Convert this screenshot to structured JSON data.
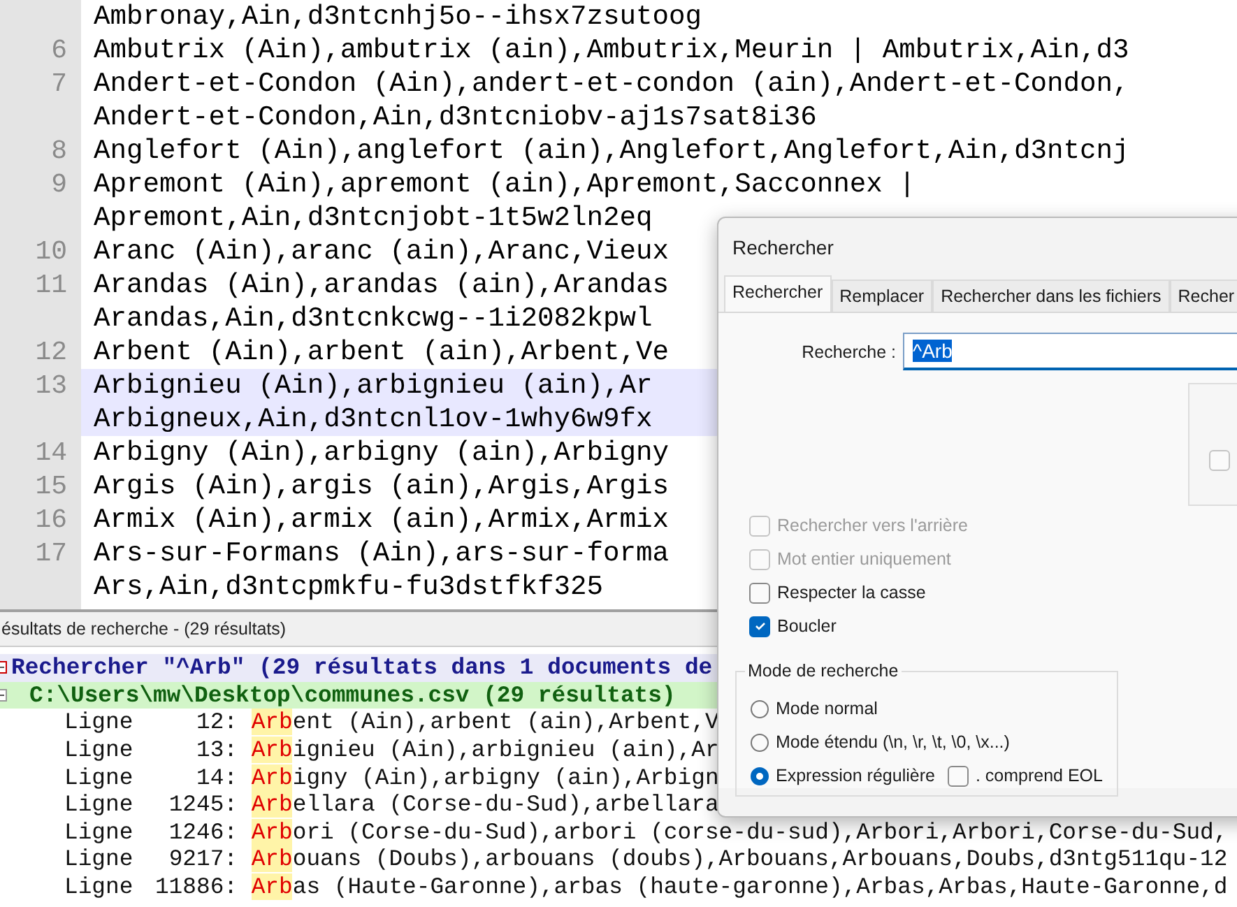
{
  "editor": {
    "lines": [
      {
        "text": "Ambronay,Ain,d3ntcnhj5o--ihsx7zsutoog",
        "current": false
      },
      {
        "number": "6",
        "text": "Ambutrix (Ain),ambutrix (ain),Ambutrix,Meurin | Ambutrix,Ain,d3",
        "current": false
      },
      {
        "number": "7",
        "text": "Andert-et-Condon (Ain),andert-et-condon (ain),Andert-et-Condon,",
        "current": false
      },
      {
        "text": "Andert-et-Condon,Ain,d3ntcniobv-aj1s7sat8i36",
        "current": false
      },
      {
        "number": "8",
        "text": "Anglefort (Ain),anglefort (ain),Anglefort,Anglefort,Ain,d3ntcnj",
        "current": false
      },
      {
        "number": "9",
        "text": "Apremont (Ain),apremont (ain),Apremont,Sacconnex |",
        "current": false
      },
      {
        "text": "Apremont,Ain,d3ntcnjobt-1t5w2ln2eq",
        "current": false
      },
      {
        "number": "10",
        "text": "Aranc (Ain),aranc (ain),Aranc,Vieux",
        "current": false
      },
      {
        "number": "11",
        "text": "Arandas (Ain),arandas (ain),Arandas",
        "current": false
      },
      {
        "text": "Arandas,Ain,d3ntcnkcwg--1i2082kpwl",
        "current": false
      },
      {
        "number": "12",
        "text": "Arbent (Ain),arbent (ain),Arbent,Ve",
        "current": false
      },
      {
        "number": "13",
        "text": "Arbignieu (Ain),arbignieu (ain),Ar",
        "current": true
      },
      {
        "text": "Arbigneux,Ain,d3ntcnl1ov-1why6w9fx",
        "current": true
      },
      {
        "number": "14",
        "text": "Arbigny (Ain),arbigny (ain),Arbigny",
        "current": false
      },
      {
        "number": "15",
        "text": "Argis (Ain),argis (ain),Argis,Argis",
        "current": false
      },
      {
        "number": "16",
        "text": "Armix (Ain),armix (ain),Armix,Armix",
        "current": false
      },
      {
        "number": "17",
        "text": "Ars-sur-Formans (Ain),ars-sur-forma",
        "current": false
      },
      {
        "text": "Ars,Ain,d3ntcpmkfu-fu3dstfkf325",
        "current": false
      }
    ]
  },
  "results": {
    "title": "ésultats de recherche - (29 résultats)",
    "search_header": "Rechercher \"^Arb\" (29 résultats dans 1 documents de",
    "file_header": "C:\\Users\\mw\\Desktop\\communes.csv (29 résultats)",
    "rows": [
      {
        "label": "Ligne",
        "line": "12:",
        "match": "Arb",
        "rest": "ent (Ain),arbent (ain),Arbent,V"
      },
      {
        "label": "Ligne",
        "line": "13:",
        "match": "Arb",
        "rest": "ignieu (Ain),arbignieu (ain),Ar"
      },
      {
        "label": "Ligne",
        "line": "14:",
        "match": "Arb",
        "rest": "igny (Ain),arbigny (ain),Arbign"
      },
      {
        "label": "Ligne",
        "line": "1245:",
        "match": "Arb",
        "rest": "ellara (Corse-du-Sud),arbellara"
      },
      {
        "label": "Ligne",
        "line": "1246:",
        "match": "Arb",
        "rest": "ori (Corse-du-Sud),arbori (corse-du-sud),Arbori,Arbori,Corse-du-Sud,"
      },
      {
        "label": "Ligne",
        "line": "9217:",
        "match": "Arb",
        "rest": "ouans (Doubs),arbouans (doubs),Arbouans,Arbouans,Doubs,d3ntg511qu-12"
      },
      {
        "label": "Ligne",
        "line": "11886:",
        "match": "Arb",
        "rest": "as (Haute-Garonne),arbas (haute-garonne),Arbas,Arbas,Haute-Garonne,d"
      }
    ]
  },
  "dialog": {
    "title": "Rechercher",
    "tabs": [
      {
        "label": "Rechercher",
        "selected": true
      },
      {
        "label": "Remplacer",
        "selected": false
      },
      {
        "label": "Rechercher dans les fichiers",
        "selected": false
      },
      {
        "label": "Recher",
        "selected": false
      }
    ],
    "search_label": "Recherche :",
    "search_value": "^Arb",
    "side_checkbox": {
      "checked": false,
      "disabled": true
    },
    "options": [
      {
        "label": "Rechercher vers l'arrière",
        "checked": false,
        "disabled": true
      },
      {
        "label": "Mot entier uniquement",
        "checked": false,
        "disabled": true
      },
      {
        "label": "Respecter la casse",
        "checked": false,
        "disabled": false
      },
      {
        "label": "Boucler",
        "checked": true,
        "disabled": false
      }
    ],
    "mode_title": "Mode de recherche",
    "modes": [
      {
        "label": "Mode normal",
        "selected": false
      },
      {
        "label": "Mode étendu (\\n, \\r, \\t, \\0, \\x...)",
        "selected": false
      },
      {
        "label": "Expression régulière",
        "selected": true
      }
    ],
    "eol_option": {
      "label": ". comprend EOL",
      "checked": false
    }
  }
}
